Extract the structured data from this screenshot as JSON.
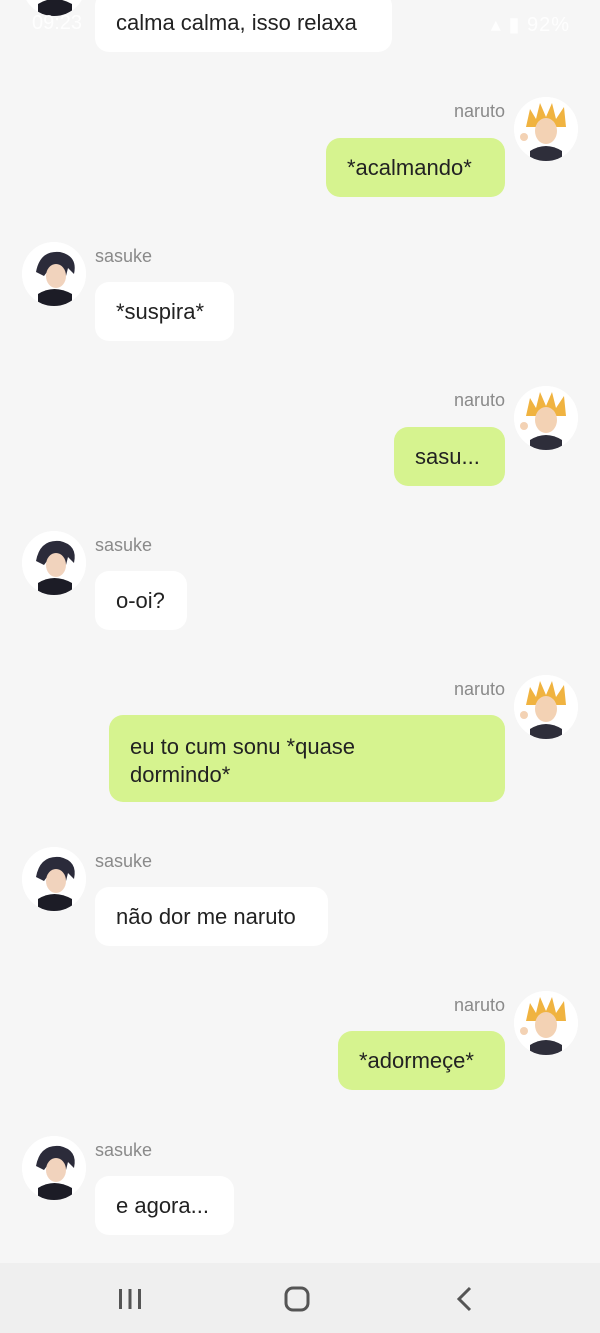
{
  "status_bar": {
    "time": "09:23",
    "battery": "92%"
  },
  "messages": [
    {
      "author": "sasuke",
      "side": "left",
      "text": "calma calma, isso relaxa",
      "show_name": false
    },
    {
      "author": "naruto",
      "side": "right",
      "text": "*acalmando*",
      "show_name": true
    },
    {
      "author": "sasuke",
      "side": "left",
      "text": "*suspira*",
      "show_name": true
    },
    {
      "author": "naruto",
      "side": "right",
      "text": "sasu...",
      "show_name": true
    },
    {
      "author": "sasuke",
      "side": "left",
      "text": "o-oi?",
      "show_name": true
    },
    {
      "author": "naruto",
      "side": "right",
      "text": "eu to cum sonu *quase dormindo*",
      "show_name": true
    },
    {
      "author": "sasuke",
      "side": "left",
      "text": "não dor me naruto",
      "show_name": true
    },
    {
      "author": "naruto",
      "side": "right",
      "text": "*adormeçe*",
      "show_name": true
    },
    {
      "author": "sasuke",
      "side": "left",
      "text": "e agora...",
      "show_name": true
    }
  ],
  "colors": {
    "background": "#f6f6f6",
    "bubble_left": "#ffffff",
    "bubble_right": "#d6f38f",
    "name_text": "#8a8a8a"
  },
  "nav_bar": {
    "icons": [
      "recent-apps-icon",
      "home-icon",
      "back-icon"
    ]
  }
}
